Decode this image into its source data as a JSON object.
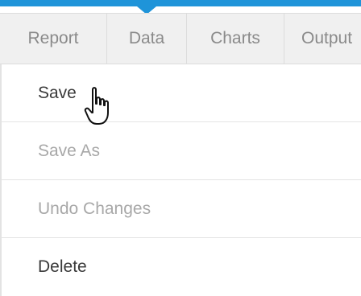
{
  "tabs": [
    {
      "label": "Report"
    },
    {
      "label": "Data"
    },
    {
      "label": "Charts"
    },
    {
      "label": "Output"
    }
  ],
  "menu": {
    "items": [
      {
        "label": "Save",
        "enabled": true
      },
      {
        "label": "Save As",
        "enabled": false
      },
      {
        "label": "Undo Changes",
        "enabled": false
      },
      {
        "label": "Delete",
        "enabled": true
      }
    ]
  },
  "colors": {
    "accent": "#1f94d9",
    "tab_bg": "#f0f0f0",
    "text_enabled": "#3a3a3a",
    "text_disabled": "#a8a8a8"
  },
  "icons": {
    "cursor": "hand-pointer-icon"
  }
}
